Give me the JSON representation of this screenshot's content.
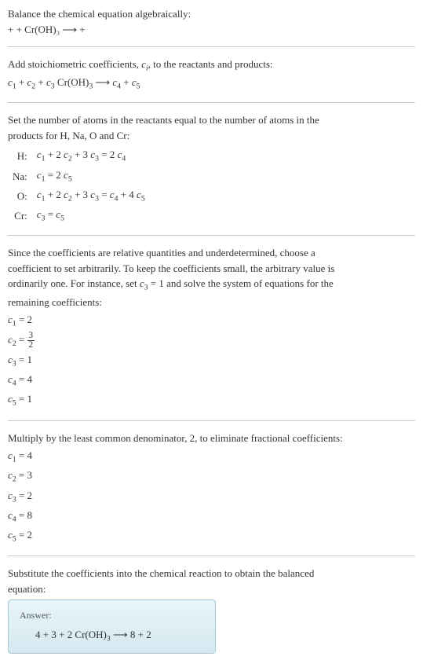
{
  "intro": {
    "line1": "Balance the chemical equation algebraically:",
    "line2": " +  + Cr(OH)₃ ⟶  + "
  },
  "stoich": {
    "line1": "Add stoichiometric coefficients, cᵢ, to the reactants and products:",
    "line2": "c₁  + c₂  + c₃ Cr(OH)₃ ⟶ c₄  + c₅ "
  },
  "atoms": {
    "intro1": "Set the number of atoms in the reactants equal to the number of atoms in the",
    "intro2": "products for H, Na, O and Cr:",
    "rows": [
      {
        "el": "H:",
        "eq": "c₁ + 2 c₂ + 3 c₃ = 2 c₄"
      },
      {
        "el": "Na:",
        "eq": "c₁ = 2 c₅"
      },
      {
        "el": "O:",
        "eq": "c₁ + 2 c₂ + 3 c₃ = c₄ + 4 c₅"
      },
      {
        "el": "Cr:",
        "eq": "c₃ = c₅"
      }
    ]
  },
  "solve": {
    "p1": "Since the coefficients are relative quantities and underdetermined, choose a",
    "p2": "coefficient to set arbitrarily. To keep the coefficients small, the arbitrary value is",
    "p3": "ordinarily one. For instance, set c₃ = 1 and solve the system of equations for the",
    "p4": "remaining coefficients:",
    "coefs": {
      "c1": "c₁ = 2",
      "c2a": "c₂ = ",
      "c2num": "3",
      "c2den": "2",
      "c3": "c₃ = 1",
      "c4": "c₄ = 4",
      "c5": "c₅ = 1"
    }
  },
  "multiply": {
    "intro": "Multiply by the least common denominator, 2, to eliminate fractional coefficients:",
    "coefs": {
      "c1": "c₁ = 4",
      "c2": "c₂ = 3",
      "c3": "c₃ = 2",
      "c4": "c₄ = 8",
      "c5": "c₅ = 2"
    }
  },
  "final": {
    "p1": "Substitute the coefficients into the chemical reaction to obtain the balanced",
    "p2": "equation:"
  },
  "answer": {
    "label": "Answer:",
    "eq": "4  + 3  + 2 Cr(OH)₃ ⟶ 8  + 2 "
  }
}
